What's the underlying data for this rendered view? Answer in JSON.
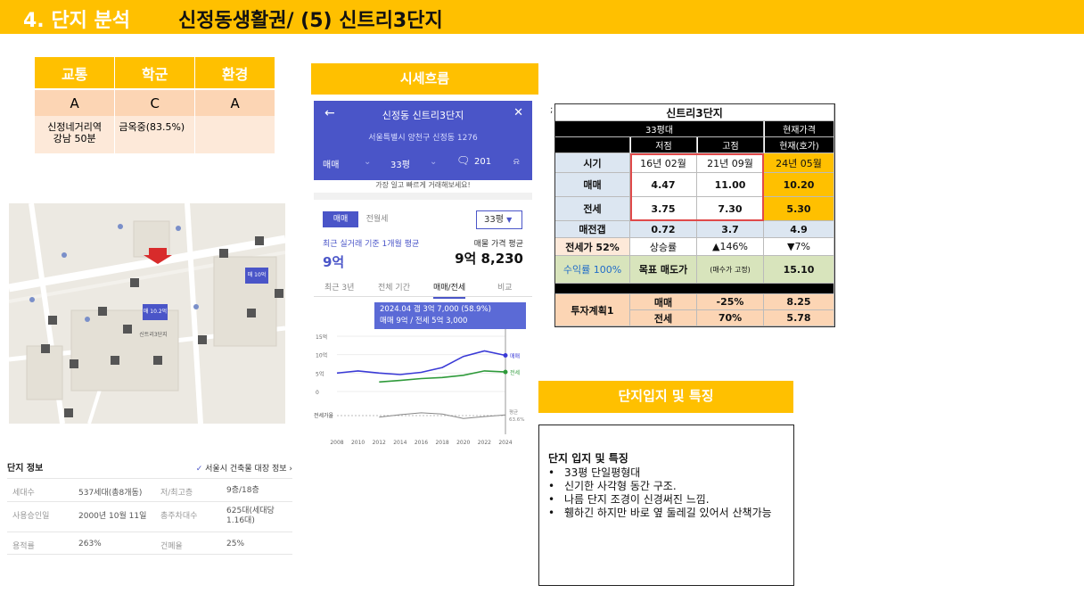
{
  "header": {
    "section": "4. 단지 분석",
    "title": "신정동생활권/ (5) 신트리3단지"
  },
  "rating": {
    "headers": [
      "교통",
      "학군",
      "환경"
    ],
    "grades": [
      "A",
      "C",
      "A"
    ],
    "notes": [
      "신정네거리역\n강남 50분",
      "금옥중(83.5%)",
      ""
    ]
  },
  "map": {
    "labels": [
      "신트리3단지",
      "매 10.2억",
      "매 10억"
    ]
  },
  "complex_info": {
    "title": "단지 정보",
    "link": "서울시 건축물 대장 정보",
    "rows": [
      [
        "세대수",
        "537세대(총8개동)",
        "저/최고층",
        "9층/18층"
      ],
      [
        "사용승인일",
        "2000년 10월 11일",
        "총주차대수",
        "625대(세대당 1.16대)"
      ],
      [
        "용적률",
        "263%",
        "건폐율",
        "25%"
      ]
    ]
  },
  "price_flow": {
    "banner": "시세흐름",
    "app": {
      "name": "신정동 신트리3단지",
      "address": "서울특별시 양천구 신정동 1276",
      "bar": {
        "type": "매매",
        "size": "33평",
        "comments": "201"
      },
      "notice": "가장 일고 빠르게 거래해보세요!",
      "tabs": [
        "매매",
        "전월세"
      ],
      "size_select": "33평",
      "recent_label": "최근 실거래 기준 1개월 평균",
      "recent_value": "9억",
      "listing_label": "매물 가격 평균",
      "listing_value": "9억 8,230",
      "periods": [
        "최근 3년",
        "전체 기간",
        "매매/전세",
        "비교"
      ],
      "tooltip_line1": "2024.04  갭 3억 7,000 (58.9%)",
      "tooltip_line2": "매매 9억 / 전세 5억 3,000"
    }
  },
  "chart_data": {
    "type": "line",
    "x": [
      2008,
      2010,
      2012,
      2014,
      2016,
      2018,
      2020,
      2022,
      2024
    ],
    "xticklabels": [
      "2008",
      "2010",
      "2012",
      "2014",
      "2016",
      "2018",
      "2020",
      "2022",
      "2024"
    ],
    "yticks": [
      "15억",
      "10억",
      "5억",
      "0"
    ],
    "ylim": [
      0,
      15
    ],
    "series": [
      {
        "name": "매매",
        "color": "#3a3ad6",
        "values": [
          5.0,
          5.6,
          5.0,
          4.6,
          5.2,
          6.5,
          9.5,
          11.0,
          9.8
        ]
      },
      {
        "name": "전세",
        "color": "#2e9a3a",
        "values": [
          null,
          null,
          2.6,
          3.0,
          3.5,
          3.8,
          4.4,
          5.6,
          5.3
        ]
      }
    ],
    "gap_label": "전세가율",
    "gap_series": {
      "name": "평균",
      "value_label": "63.6%",
      "values": [
        null,
        null,
        52,
        60,
        66,
        62,
        48,
        54,
        59
      ]
    }
  },
  "summary": {
    "title": "신트리3단지",
    "col_group": "33평대",
    "current_label": "현재가격",
    "cols": [
      "저점",
      "고점",
      "현재(호가)"
    ],
    "rows": [
      {
        "label": "시기",
        "v": [
          "16년 02월",
          "21년 09월",
          "24년 05월"
        ]
      },
      {
        "label": "매매",
        "v": [
          "4.47",
          "11.00",
          "10.20"
        ]
      },
      {
        "label": "전세",
        "v": [
          "3.75",
          "7.30",
          "5.30"
        ]
      },
      {
        "label": "매전갭",
        "v": [
          "0.72",
          "3.7",
          "4.9"
        ]
      }
    ],
    "jeonse_ratio": "전세가 52%",
    "growth_label": "상승률",
    "growth_up": "▲146%",
    "growth_down": "▼7%",
    "yield_label": "수익률 100%",
    "target_label": "목표 매도가",
    "target_note": "(매수가 고정)",
    "target_value": "15.10",
    "plan_label": "투자계획1",
    "plan_rows": [
      {
        "label": "매매",
        "pct": "-25%",
        "val": "8.25"
      },
      {
        "label": "전세",
        "pct": "70%",
        "val": "5.78"
      }
    ]
  },
  "features": {
    "banner": "단지입지 및 특징",
    "heading": "단지 입지 및 특징",
    "items": [
      "33평 단일평형대",
      "신기한 사각형 동간 구조.",
      "나름 단지 조경이 신경써진 느낌.",
      "휑하긴 하지만 바로 옆 둘레길 있어서 산책가능"
    ]
  }
}
